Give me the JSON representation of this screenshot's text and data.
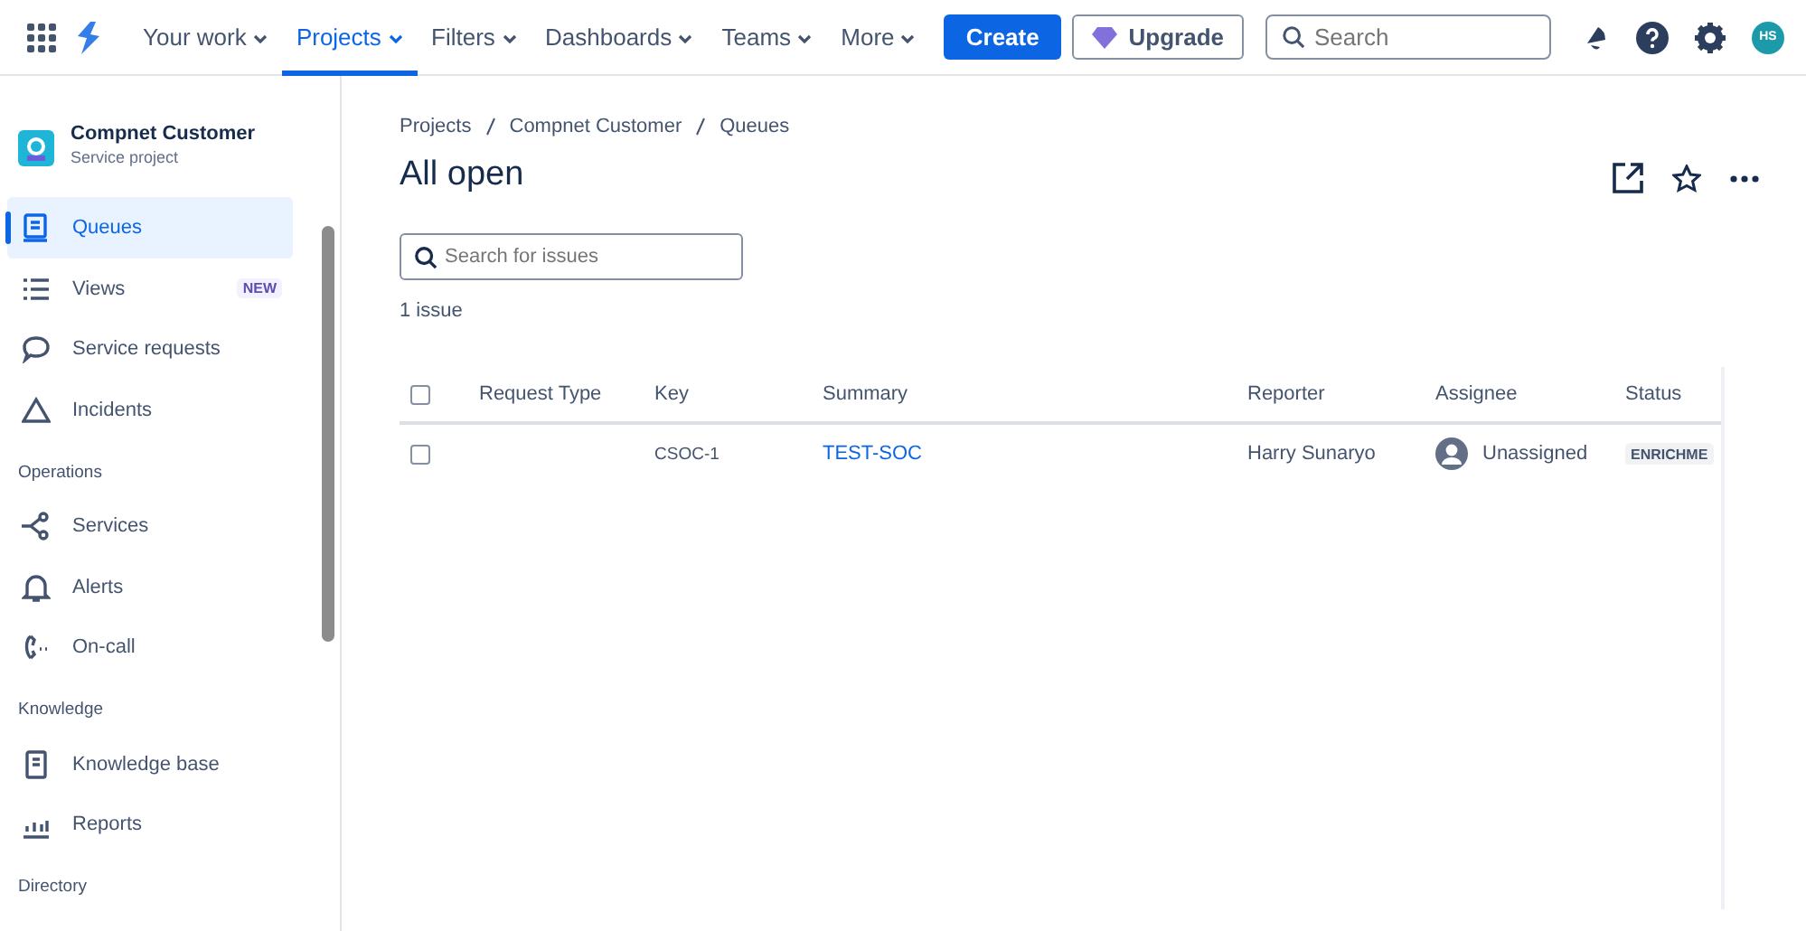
{
  "topnav": {
    "items": [
      {
        "label": "Your work",
        "selected": false
      },
      {
        "label": "Projects",
        "selected": true
      },
      {
        "label": "Filters",
        "selected": false
      },
      {
        "label": "Dashboards",
        "selected": false
      },
      {
        "label": "Teams",
        "selected": false
      },
      {
        "label": "More",
        "selected": false
      }
    ],
    "create": "Create",
    "upgrade": "Upgrade",
    "search": {
      "placeholder": "Search"
    },
    "avatar": "HS"
  },
  "sidebar": {
    "project": {
      "name": "Compnet Customer",
      "type": "Service project"
    },
    "sections": [
      {
        "items": [
          {
            "label": "Queues",
            "kind": "queue",
            "selected": true
          },
          {
            "label": "Views",
            "kind": "list",
            "selected": false,
            "badge": "NEW"
          },
          {
            "label": "Service requests",
            "kind": "chat",
            "selected": false
          },
          {
            "label": "Incidents",
            "kind": "triangle",
            "selected": false
          }
        ]
      },
      {
        "heading": "Operations",
        "items": [
          {
            "label": "Services",
            "kind": "nodes",
            "selected": false
          },
          {
            "label": "Alerts",
            "kind": "bell",
            "selected": false
          },
          {
            "label": "On-call",
            "kind": "phone",
            "selected": false
          }
        ]
      },
      {
        "heading": "Knowledge",
        "items": [
          {
            "label": "Knowledge base",
            "kind": "book",
            "selected": false
          },
          {
            "label": "Reports",
            "kind": "chart",
            "selected": false
          }
        ]
      },
      {
        "heading": "Directory"
      }
    ]
  },
  "breadcrumbs": [
    "Projects",
    "Compnet Customer",
    "Queues"
  ],
  "title": "All open",
  "issue_search": {
    "placeholder": "Search for issues"
  },
  "count": "1 issue",
  "table": {
    "header_checked": false,
    "columns": [
      "Request Type",
      "Key",
      "Summary",
      "Reporter",
      "Assignee",
      "Status"
    ],
    "rows": [
      {
        "checked": false,
        "key": "CSOC-1",
        "summary": "TEST-SOC",
        "reporter": "Harry Sunaryo",
        "assignee": "Unassigned",
        "status": "ENRICHME"
      }
    ]
  }
}
